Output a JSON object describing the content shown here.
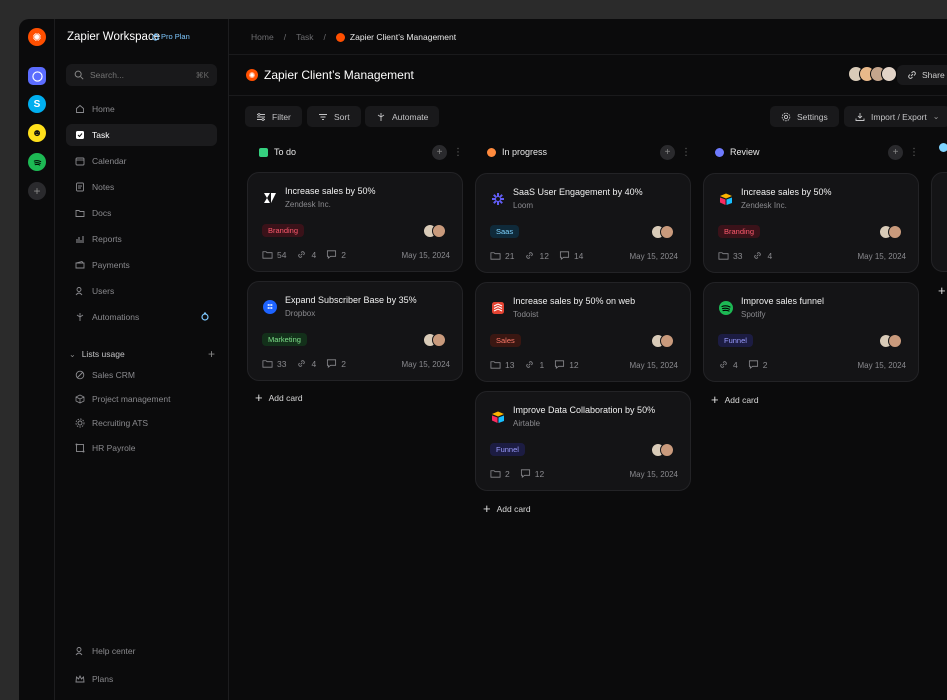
{
  "workspace": {
    "title": "Zapier Workspace",
    "plan": "Pro Plan"
  },
  "search": {
    "placeholder": "Search...",
    "shortcut": "⌘K"
  },
  "nav": [
    {
      "label": "Home",
      "icon": "home-icon"
    },
    {
      "label": "Task",
      "icon": "task-icon"
    },
    {
      "label": "Calendar",
      "icon": "calendar-icon"
    },
    {
      "label": "Notes",
      "icon": "notes-icon"
    },
    {
      "label": "Docs",
      "icon": "docs-icon"
    },
    {
      "label": "Reports",
      "icon": "reports-icon"
    },
    {
      "label": "Payments",
      "icon": "payments-icon"
    },
    {
      "label": "Users",
      "icon": "users-icon"
    },
    {
      "label": "Automations",
      "icon": "automations-icon"
    }
  ],
  "lists": {
    "title": "Lists usage",
    "items": [
      "Sales CRM",
      "Project management",
      "Recruiting ATS",
      "HR Payrole"
    ]
  },
  "footer": {
    "help": "Help center",
    "plans": "Plans"
  },
  "breadcrumb": {
    "home": "Home",
    "task": "Task",
    "current": "Zapier Client’s Management"
  },
  "page": {
    "title": "Zapier Client’s Management",
    "share": "Share"
  },
  "toolbar": {
    "filter": "Filter",
    "sort": "Sort",
    "automate": "Automate",
    "settings": "Settings",
    "import_export": "Import / Export"
  },
  "columns": [
    {
      "title": "To do",
      "color": "#35d07f",
      "cards": [
        {
          "title": "Increase sales by 50%",
          "company": "Zendesk Inc.",
          "tag": "Branding",
          "tag_color": "#ff5a6e",
          "tag_bg": "#3a1219",
          "files": "54",
          "links": "4",
          "comments": "2",
          "date": "May 15, 2024",
          "logo": "zendesk-logo"
        },
        {
          "title": "Expand Subscriber Base by 35%",
          "company": "Dropbox",
          "tag": "Marketing",
          "tag_color": "#7ee08a",
          "tag_bg": "#13301a",
          "files": "33",
          "links": "4",
          "comments": "2",
          "date": "May 15, 2024",
          "logo": "dropbox-logo"
        }
      ]
    },
    {
      "title": "In progress",
      "color": "#ff8a3d",
      "cards": [
        {
          "title": "SaaS User Engagement by 40%",
          "company": "Loom",
          "tag": "Saas",
          "tag_color": "#7fd4ff",
          "tag_bg": "#0f2a3a",
          "files": "21",
          "links": "12",
          "comments": "14",
          "date": "May 15, 2024",
          "logo": "loom-logo"
        },
        {
          "title": "Increase sales by 50% on web",
          "company": "Todoist",
          "tag": "Sales",
          "tag_color": "#ff7a6a",
          "tag_bg": "#3a1712",
          "files": "13",
          "links": "1",
          "comments": "12",
          "date": "May 15, 2024",
          "logo": "todoist-logo"
        },
        {
          "title": "Improve Data Collaboration by 50%",
          "company": "Airtable",
          "tag": "Funnel",
          "tag_color": "#9a9cff",
          "tag_bg": "#1c1c42",
          "files": "2",
          "links": "",
          "comments": "12",
          "date": "May 15, 2024",
          "logo": "airtable-logo"
        }
      ]
    },
    {
      "title": "Review",
      "color": "#6f7bff",
      "cards": [
        {
          "title": "Increase sales by 50%",
          "company": "Zendesk Inc.",
          "tag": "Branding",
          "tag_color": "#ff5a6e",
          "tag_bg": "#3a1219",
          "files": "33",
          "links": "4",
          "comments": "",
          "date": "May 15, 2024",
          "logo": "airtable-logo"
        },
        {
          "title": "Improve sales funnel",
          "company": "Spotify",
          "tag": "Funnel",
          "tag_color": "#9a9cff",
          "tag_bg": "#1c1c42",
          "files": "",
          "links": "4",
          "comments": "2",
          "date": "May 15, 2024",
          "logo": "spotify-logo"
        }
      ]
    }
  ],
  "add_card": "Add card"
}
